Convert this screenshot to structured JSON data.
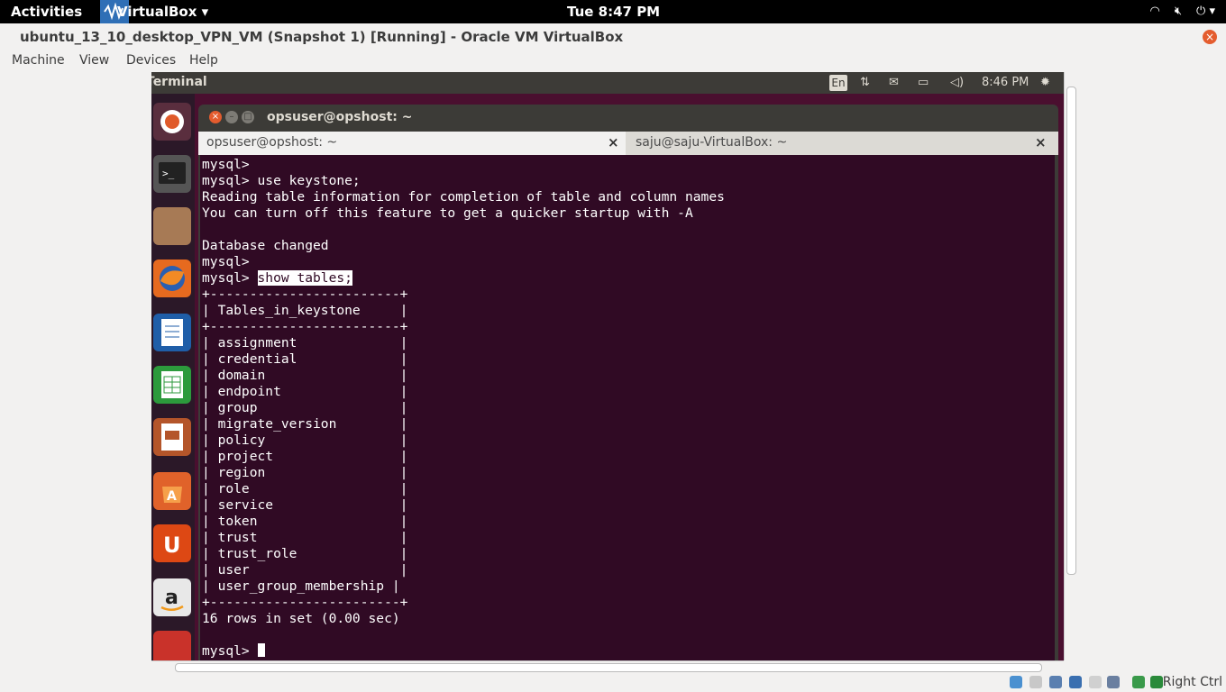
{
  "host_topbar": {
    "activities": "Activities",
    "app_name": "VirtualBox ▾",
    "clock": "Tue  8:47 PM",
    "tray_icons": [
      "wifi-icon",
      "volume-muted-icon",
      "power-icon"
    ]
  },
  "vbox_window": {
    "title": "ubuntu_13_10_desktop_VPN_VM (Snapshot 1) [Running] - Oracle VM VirtualBox",
    "menu": [
      "Machine",
      "View",
      "Devices",
      "Help"
    ]
  },
  "guest_panel": {
    "app_title": "Terminal",
    "keyboard": "En",
    "clock": "8:46 PM"
  },
  "terminal_window": {
    "title": "opsuser@opshost: ~",
    "tabs": [
      {
        "label": "opsuser@opshost: ~",
        "active": true
      },
      {
        "label": "saju@saju-VirtualBox: ~",
        "active": false
      }
    ]
  },
  "terminal": {
    "before_highlight": "mysql>\nmysql> use keystone;\nReading table information for completion of table and column names\nYou can turn off this feature to get a quicker startup with -A\n\nDatabase changed\nmysql>\nmysql> ",
    "highlight": "show tables;",
    "after_highlight": "\n+------------------------+\n| Tables_in_keystone     |\n+------------------------+\n| assignment             |\n| credential             |\n| domain                 |\n| endpoint               |\n| group                  |\n| migrate_version        |\n| policy                 |\n| project                |\n| region                 |\n| role                   |\n| service                |\n| token                  |\n| trust                  |\n| trust_role             |\n| user                   |\n| user_group_membership |\n+------------------------+\n16 rows in set (0.00 sec)\n\nmysql> "
  },
  "statusbar": {
    "host_key": "Right Ctrl"
  }
}
